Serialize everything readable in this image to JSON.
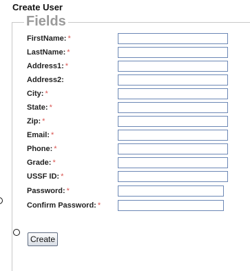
{
  "page": {
    "title": "Create User"
  },
  "form": {
    "legend": "Fields",
    "required_marker": "*",
    "fields": [
      {
        "label": "FirstName:",
        "required": true
      },
      {
        "label": "LastName:",
        "required": true
      },
      {
        "label": "Address1:",
        "required": true
      },
      {
        "label": "Address2:",
        "required": false
      },
      {
        "label": "City:",
        "required": true
      },
      {
        "label": "State:",
        "required": true
      },
      {
        "label": "Zip:",
        "required": true
      },
      {
        "label": "Email:",
        "required": true
      },
      {
        "label": "Phone:",
        "required": true
      },
      {
        "label": "Grade:",
        "required": true
      },
      {
        "label": "USSF ID:",
        "required": true
      },
      {
        "label": "Password:",
        "required": true
      },
      {
        "label": "Confirm Password:",
        "required": true
      }
    ],
    "submit_label": "Create"
  }
}
